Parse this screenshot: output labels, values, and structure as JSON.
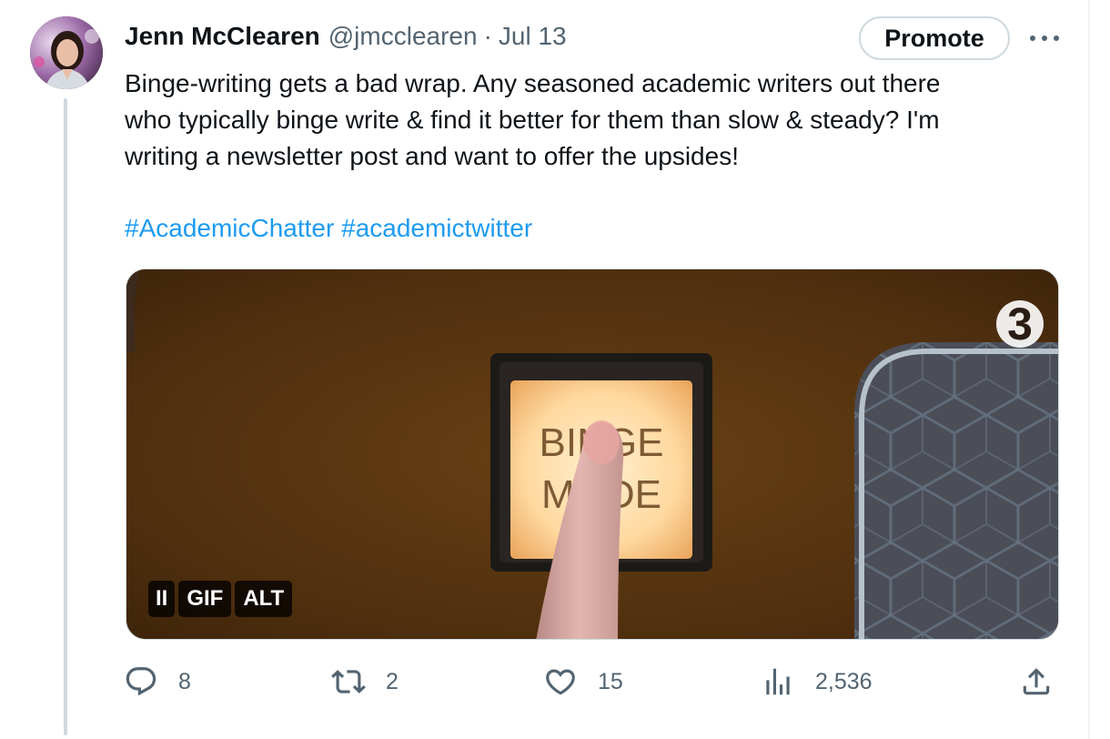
{
  "tweet": {
    "author": {
      "display_name": "Jenn McClearen",
      "handle": "@jmcclearen",
      "separator": "·",
      "date": "Jul 13"
    },
    "promote_label": "Promote",
    "text_lines": [
      "Binge-writing gets a bad wrap. Any seasoned academic writers out there",
      "who typically binge write & find it better for them than slow & steady? I'm",
      "writing a newsletter post and want to offer the upsides!"
    ],
    "hashtags": [
      "#AcademicChatter",
      "#academictwitter"
    ],
    "media": {
      "type": "gif",
      "button_text": "BINGE MODE",
      "watermark": "3",
      "badges": {
        "pause": "II",
        "gif": "GIF",
        "alt": "ALT"
      }
    },
    "actions": {
      "replies": "8",
      "retweets": "2",
      "likes": "15",
      "views": "2,536"
    }
  },
  "colors": {
    "text": "#0f1419",
    "secondary": "#536471",
    "link": "#1d9bf0",
    "border": "#cfd9de"
  },
  "icons": [
    "more-horizontal-icon",
    "reply-icon",
    "retweet-icon",
    "like-icon",
    "views-icon",
    "share-icon",
    "pause-icon"
  ]
}
